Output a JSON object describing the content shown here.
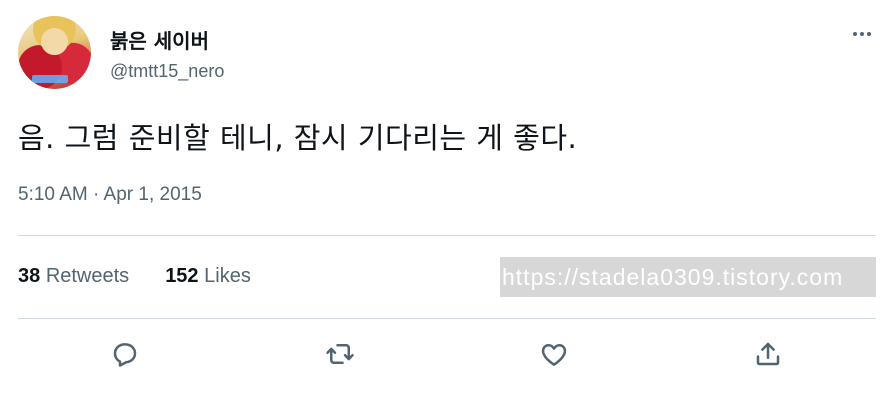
{
  "tweet": {
    "display_name": "붉은 세이버",
    "handle": "@tmtt15_nero",
    "text": "음. 그럼 준비할 테니, 잠시 기다리는 게 좋다.",
    "timestamp": "5:10 AM · Apr 1, 2015",
    "retweets_count": "38",
    "retweets_label": "Retweets",
    "likes_count": "152",
    "likes_label": "Likes"
  },
  "watermark": "https://stadela0309.tistory.com",
  "icons": {
    "more": "more-icon",
    "reply": "reply-icon",
    "retweet": "retweet-icon",
    "like": "like-icon",
    "share": "share-icon"
  },
  "colors": {
    "primary_text": "#0f1419",
    "secondary_text": "#536471",
    "divider": "#cfd9de"
  }
}
